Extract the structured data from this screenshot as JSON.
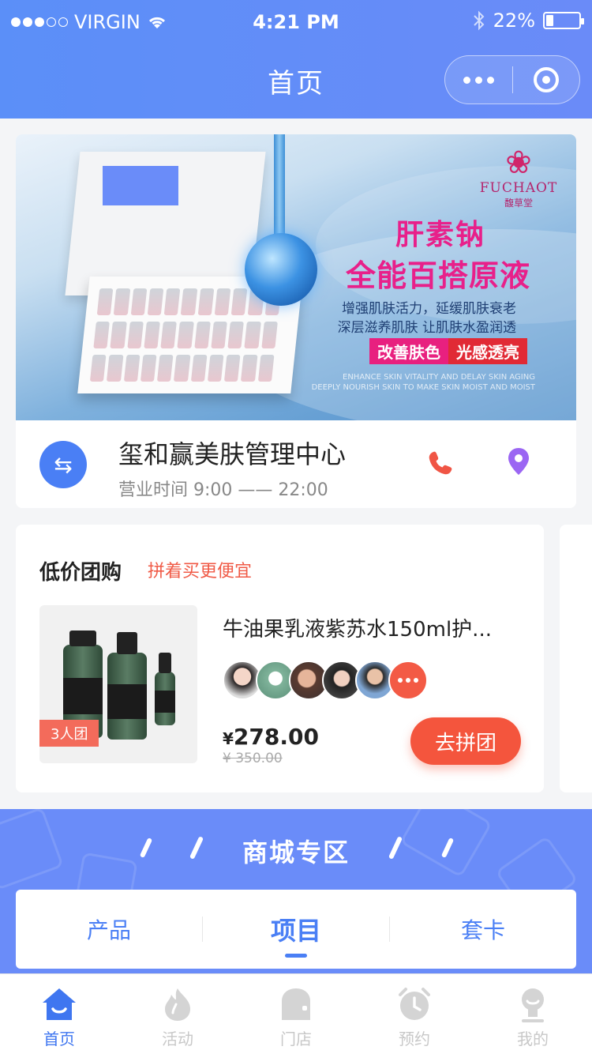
{
  "status_bar": {
    "carrier": "VIRGIN",
    "time": "4:21 PM",
    "battery": "22%",
    "battery_level": 0.22
  },
  "nav": {
    "title": "首页"
  },
  "banner": {
    "brand_name": "FUCHAOT",
    "brand_cn": "馥草堂",
    "title_line1": "肝素钠",
    "title_line2": "全能百搭原液",
    "line1": "增强肌肤活力，延缓肌肤衰老",
    "line2": "深层滋养肌肤 让肌肤水盈润透",
    "tag1": "改善肤色",
    "tag2": "光感透亮",
    "en_line1": "ENHANCE SKIN VITALITY AND DELAY SKIN AGING",
    "en_line2": "DEEPLY NOURISH SKIN TO MAKE SKIN MOIST AND MOIST"
  },
  "store": {
    "name": "玺和赢美肤管理中心",
    "hours": "营业时间   9:00 —— 22:00"
  },
  "group_buy": {
    "title": "低价团购",
    "subtitle": "拼着买更便宜",
    "product": {
      "name": "牛油果乳液紫苏水150ml护...",
      "team_tag": "3人团",
      "price_symbol": "¥",
      "price": "278.00",
      "old_price": "¥ 350.00",
      "button": "去拼团"
    }
  },
  "mall": {
    "title": "商城专区",
    "tabs": [
      {
        "label": "产品"
      },
      {
        "label": "项目"
      },
      {
        "label": "套卡"
      }
    ],
    "active_tab": "项目"
  },
  "tabbar": [
    {
      "label": "首页",
      "icon": "home-icon",
      "active": true
    },
    {
      "label": "活动",
      "icon": "activity-icon",
      "active": false
    },
    {
      "label": "门店",
      "icon": "store-icon",
      "active": false
    },
    {
      "label": "预约",
      "icon": "alarm-icon",
      "active": false
    },
    {
      "label": "我的",
      "icon": "user-icon",
      "active": false
    }
  ],
  "colors": {
    "primary": "#4a7ff5",
    "header": "#6a8bf8",
    "accent": "#f4553d"
  }
}
